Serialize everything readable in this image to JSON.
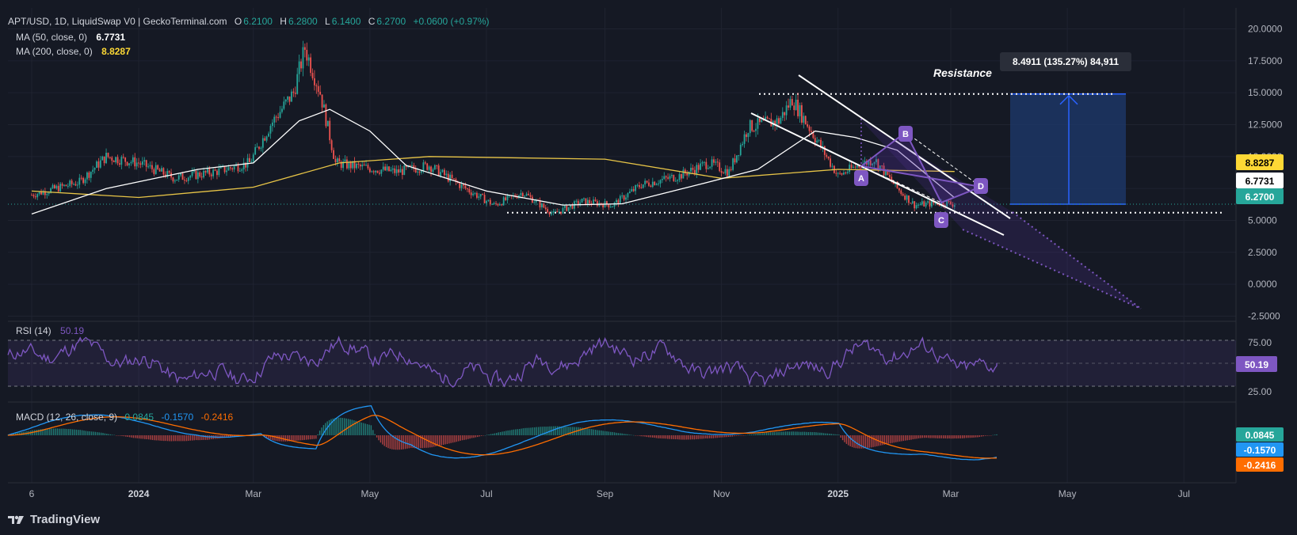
{
  "header": {
    "symbol": "APT/USD, 1D, LiquidSwap V0 | GeckoTerminal.com",
    "o_label": "O",
    "o_value": "6.2100",
    "h_label": "H",
    "h_value": "6.2800",
    "l_label": "L",
    "l_value": "6.1400",
    "c_label": "C",
    "c_value": "6.2700",
    "change": "+0.0600 (+0.97%)"
  },
  "ma50": {
    "label": "MA (50, close, 0)",
    "value": "6.7731"
  },
  "ma200": {
    "label": "MA (200, close, 0)",
    "value": "8.8287"
  },
  "rsi": {
    "label": "RSI (14)",
    "value": "50.19"
  },
  "macd": {
    "label": "MACD (12, 26, close, 9)",
    "v1": "0.0845",
    "v2": "-0.1570",
    "v3": "-0.2416"
  },
  "annotations": {
    "resistance": "Resistance",
    "measure": "8.4911 (135.27%) 84,911",
    "points": [
      "A",
      "B",
      "C",
      "D"
    ]
  },
  "price_badges": {
    "ma200": "8.8287",
    "ma50": "6.7731",
    "last": "6.2700"
  },
  "rsi_badge": "50.19",
  "macd_badges": [
    "0.0845",
    "-0.1570",
    "-0.2416"
  ],
  "footer": {
    "brand": "TradingView"
  },
  "colors": {
    "bg": "#151924",
    "up": "#26a69a",
    "down": "#ef5350",
    "ma50": "#ffffff",
    "ma200": "#e8c547",
    "rsi": "#7e57c2",
    "macd": "#2196f3",
    "signal": "#ff6d00",
    "measure": "#1e3a6e"
  },
  "chart_data": {
    "type": "candlestick",
    "y_axis": {
      "ticks": [
        "20.0000",
        "17.5000",
        "15.0000",
        "12.5000",
        "10.0000",
        "7.5000",
        "5.0000",
        "2.5000",
        "0.0000",
        "-2.5000"
      ],
      "ylim": [
        -2.5,
        20
      ]
    },
    "x_axis": {
      "ticks": [
        "6",
        "2024",
        "Mar",
        "May",
        "Jul",
        "Sep",
        "Nov",
        "2025",
        "Mar",
        "May",
        "Jul"
      ]
    },
    "close_path": [
      [
        "Nov 6 2023",
        7.0
      ],
      [
        "Dec 1 2023",
        8.0
      ],
      [
        "Dec 15 2023",
        10.0
      ],
      [
        "Jan 1 2024",
        9.5
      ],
      [
        "Jan 20 2024",
        8.3
      ],
      [
        "Feb 10 2024",
        8.8
      ],
      [
        "Feb 28 2024",
        9.5
      ],
      [
        "Mar 10 2024",
        12.5
      ],
      [
        "Mar 22 2024",
        15.0
      ],
      [
        "Mar 28 2024",
        18.5
      ],
      [
        "Apr 5 2024",
        15.0
      ],
      [
        "Apr 13 2024",
        9.5
      ],
      [
        "Apr 25 2024",
        9.2
      ],
      [
        "May 15 2024",
        8.8
      ],
      [
        "Jun 1 2024",
        9.3
      ],
      [
        "Jun 20 2024",
        7.5
      ],
      [
        "Jul 5 2024",
        6.2
      ],
      [
        "Jul 20 2024",
        7.2
      ],
      [
        "Aug 5 2024",
        5.5
      ],
      [
        "Aug 20 2024",
        6.5
      ],
      [
        "Sep 5 2024",
        6.2
      ],
      [
        "Sep 20 2024",
        7.8
      ],
      [
        "Oct 10 2024",
        8.5
      ],
      [
        "Oct 25 2024",
        9.5
      ],
      [
        "Nov 5 2024",
        8.8
      ],
      [
        "Nov 15 2024",
        12.3
      ],
      [
        "Dec 1 2024",
        12.8
      ],
      [
        "Dec 8 2024",
        14.5
      ],
      [
        "Dec 20 2024",
        11.5
      ],
      [
        "Jan 1 2025",
        8.5
      ],
      [
        "Jan 10 2025",
        9.2
      ],
      [
        "Jan 20 2025",
        9.8
      ],
      [
        "Feb 1 2025",
        7.5
      ],
      [
        "Feb 10 2025",
        6.2
      ],
      [
        "Feb 25 2025",
        6.4
      ],
      [
        "Mar 3 2025",
        6.27
      ]
    ],
    "ma50_path": [
      [
        "Nov 6 2023",
        5.5
      ],
      [
        "Dec 15 2023",
        7.5
      ],
      [
        "Feb 1 2024",
        9.0
      ],
      [
        "Mar 1 2024",
        9.5
      ],
      [
        "Mar 25 2024",
        12.8
      ],
      [
        "Apr 10 2024",
        13.7
      ],
      [
        "May 1 2024",
        12.0
      ],
      [
        "May 20 2024",
        9.3
      ],
      [
        "Jul 1 2024",
        7.3
      ],
      [
        "Aug 10 2024",
        6.2
      ],
      [
        "Sep 10 2024",
        6.3
      ],
      [
        "Oct 20 2024",
        7.8
      ],
      [
        "Nov 20 2024",
        9.0
      ],
      [
        "Dec 20 2024",
        12.0
      ],
      [
        "Jan 10 2025",
        11.5
      ],
      [
        "Feb 1 2025",
        10.5
      ],
      [
        "Mar 3 2025",
        6.7731
      ]
    ],
    "ma200_path": [
      [
        "Nov 6 2023",
        7.3
      ],
      [
        "Jan 1 2024",
        6.8
      ],
      [
        "Mar 1 2024",
        7.6
      ],
      [
        "Apr 15 2024",
        9.5
      ],
      [
        "Jun 1 2024",
        10.0
      ],
      [
        "Sep 1 2024",
        9.8
      ],
      [
        "Nov 1 2024",
        8.3
      ],
      [
        "Jan 1 2025",
        9.0
      ],
      [
        "Mar 3 2025",
        8.8287
      ]
    ],
    "resistance_level": 14.9,
    "support_level": 5.6,
    "measure": {
      "from": 6.27,
      "to": 14.9,
      "label": "8.4911 (135.27%) 84,911"
    },
    "rsi_ticks": [
      "75.00",
      "25.00"
    ],
    "rsi_levels": [
      70,
      50,
      30
    ],
    "rsi_value": 50.19,
    "macd_values": {
      "macd": -0.157,
      "signal": -0.2416,
      "histogram": 0.0845
    }
  }
}
